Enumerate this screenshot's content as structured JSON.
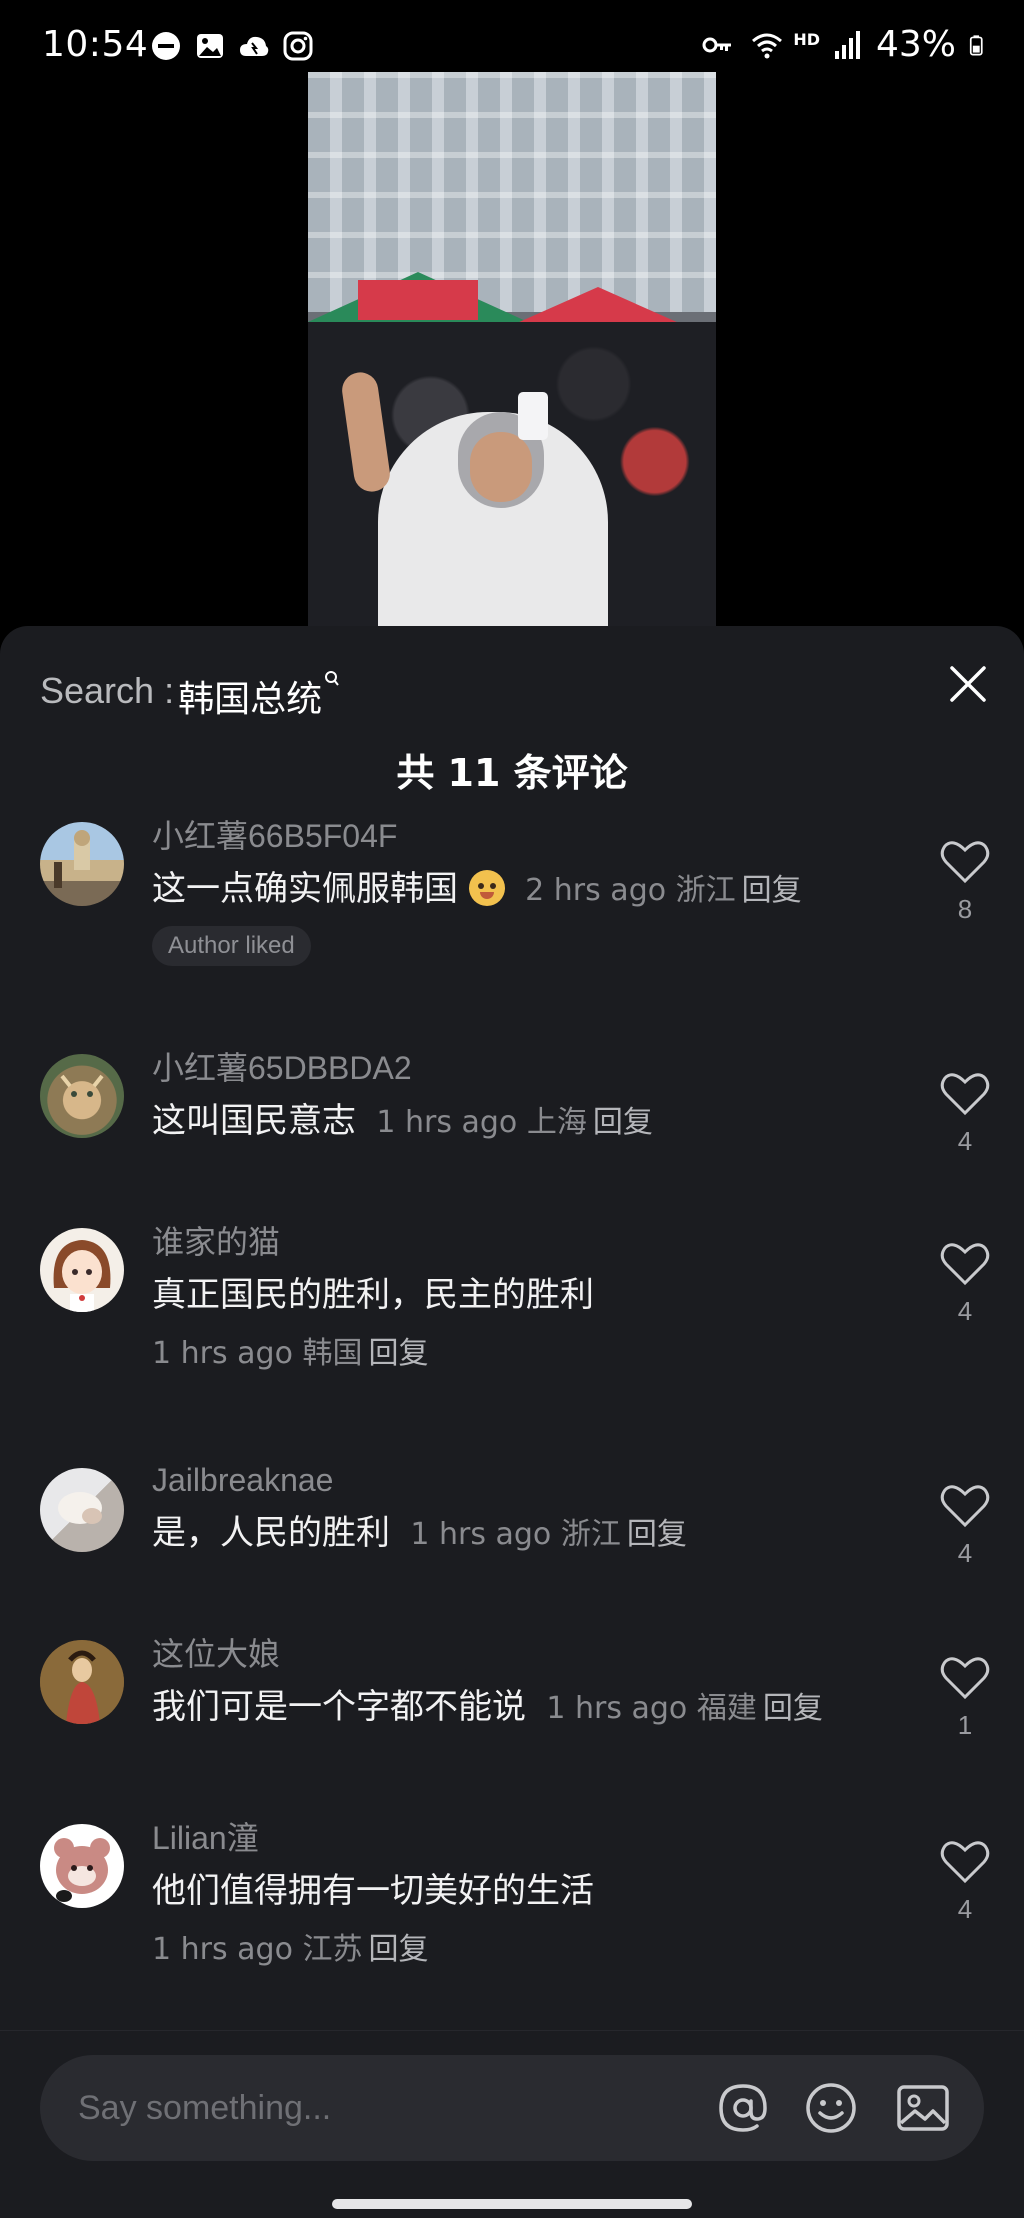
{
  "status_bar": {
    "time": "10:54",
    "battery": "43%",
    "left_icons": [
      "dnd-icon",
      "gallery-icon",
      "cloud-icon",
      "instagram-icon"
    ],
    "right_icons": [
      "vpn-key-icon",
      "wifi-icon",
      "hd-icon",
      "signal-icon",
      "battery-icon"
    ],
    "hd_label": "HD"
  },
  "sheet": {
    "search_prefix": "Search : ",
    "search_query": "韩国总统",
    "title": "共 11 条评论"
  },
  "comments": [
    {
      "user": "小红薯66B5F04F",
      "text": "这一点确实佩服韩国",
      "has_emoji": true,
      "time": "2 hrs ago",
      "location": "浙江",
      "reply": "回复",
      "likes": "8",
      "badge": "Author liked"
    },
    {
      "user": "小红薯65DBBDA2",
      "text": "这叫国民意志",
      "time": "1 hrs ago",
      "location": "上海",
      "reply": "回复",
      "likes": "4"
    },
    {
      "user": "谁家的猫",
      "text": "真正国民的胜利，民主的胜利",
      "time": "1 hrs ago",
      "location": "韩国",
      "reply": "回复",
      "likes": "4"
    },
    {
      "user": "Jailbreaknae",
      "text": "是，人民的胜利",
      "time": "1 hrs ago",
      "location": "浙江",
      "reply": "回复",
      "likes": "4"
    },
    {
      "user": "这位大娘",
      "text": "我们可是一个字都不能说",
      "time": "1 hrs ago",
      "location": "福建",
      "reply": "回复",
      "likes": "1"
    },
    {
      "user": "Lilian潼",
      "text": "他们值得拥有一切美好的生活",
      "time": "1 hrs ago",
      "location": "江苏",
      "reply": "回复",
      "likes": "4"
    }
  ],
  "input": {
    "placeholder": "Say something...",
    "icons": [
      "mention-icon",
      "emoji-icon",
      "image-icon"
    ]
  }
}
